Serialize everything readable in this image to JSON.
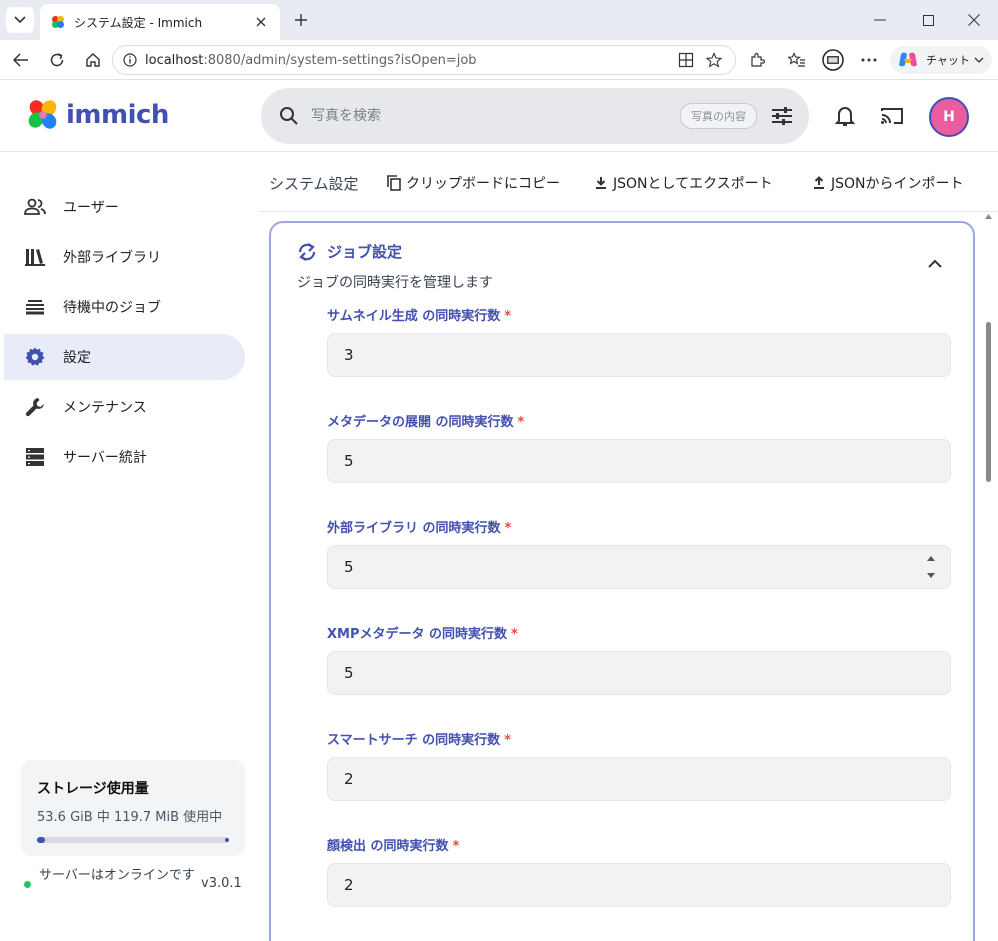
{
  "browser": {
    "tab_title": "システム設定 - Immich",
    "url_host": "localhost",
    "url_rest": ":8080/admin/system-settings?isOpen=job",
    "copilot_label": "チャット"
  },
  "app": {
    "logo_text": "immich",
    "search_placeholder": "写真を検索",
    "search_chip": "写真の内容",
    "avatar_initial": "H"
  },
  "sidebar": {
    "items": [
      {
        "label": "ユーザー",
        "icon": "users-icon"
      },
      {
        "label": "外部ライブラリ",
        "icon": "library-icon"
      },
      {
        "label": "待機中のジョブ",
        "icon": "queue-icon"
      },
      {
        "label": "設定",
        "icon": "gear-icon",
        "active": true
      },
      {
        "label": "メンテナンス",
        "icon": "wrench-icon"
      },
      {
        "label": "サーバー統計",
        "icon": "server-icon"
      }
    ],
    "storage": {
      "title": "ストレージ使用量",
      "usage": "53.6 GiB 中 119.7 MiB 使用中",
      "used_fraction": 0.002
    },
    "server_status": "サーバーはオンラインです",
    "version": "v3.0.1"
  },
  "toolbar": {
    "title": "システム設定",
    "copy": "クリップボードにコピー",
    "export": "JSONとしてエクスポート",
    "import": "JSONからインポート"
  },
  "job_settings": {
    "title": "ジョブ設定",
    "subtitle": "ジョブの同時実行を管理します",
    "fields": [
      {
        "label": "サムネイル生成 の同時実行数",
        "value": "3"
      },
      {
        "label": "メタデータの展開 の同時実行数",
        "value": "5"
      },
      {
        "label": "外部ライブラリ の同時実行数",
        "value": "5"
      },
      {
        "label": "XMPメタデータ の同時実行数",
        "value": "5"
      },
      {
        "label": "スマートサーチ の同時実行数",
        "value": "2"
      },
      {
        "label": "顔検出 の同時実行数",
        "value": "2"
      }
    ],
    "required_mark": "*"
  }
}
